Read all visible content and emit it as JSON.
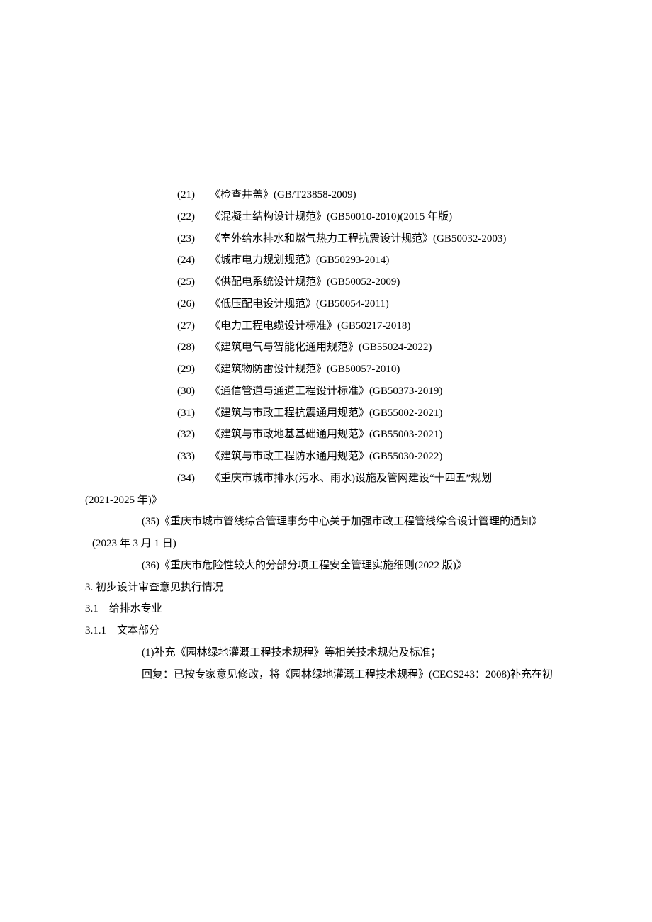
{
  "refs": [
    {
      "num": "(21)",
      "title": "《检查井盖》",
      "code": "(GB/T23858-2009)"
    },
    {
      "num": "(22)",
      "title": "《混凝土结构设计规范》",
      "code": "(GB50010-2010)(2015 年版)"
    },
    {
      "num": "(23)",
      "title": "《室外给水排水和燃气热力工程抗震设计规范》",
      "code": "(GB50032-2003)"
    },
    {
      "num": "(24)",
      "title": "《城市电力规划规范》",
      "code": "(GB50293-2014)"
    },
    {
      "num": "(25)",
      "title": "《供配电系统设计规范》",
      "code": "(GB50052-2009)"
    },
    {
      "num": "(26)",
      "title": "《低压配电设计规范》",
      "code": "(GB50054-2011)"
    },
    {
      "num": "(27)",
      "title": "《电力工程电缆设计标准》",
      "code": "(GB50217-2018)"
    },
    {
      "num": "(28)",
      "title": "《建筑电气与智能化通用规范》",
      "code": "(GB55024-2022)"
    },
    {
      "num": "(29)",
      "title": "《建筑物防雷设计规范》",
      "code": "(GB50057-2010)"
    },
    {
      "num": "(30)",
      "title": "《通信管道与通道工程设计标准》",
      "code": "(GB50373-2019)"
    },
    {
      "num": "(31)",
      "title": "《建筑与市政工程抗震通用规范》",
      "code": "(GB55002-2021)"
    },
    {
      "num": "(32)",
      "title": "《建筑与市政地基基础通用规范》",
      "code": "(GB55003-2021)"
    },
    {
      "num": "(33)",
      "title": "《建筑与市政工程防水通用规范》",
      "code": "(GB55030-2022)"
    }
  ],
  "ref34": {
    "num": "(34)",
    "line1": "《重庆市城市排水(污水、雨水)设施及管网建设“十四五”规划",
    "line2": "(2021-2025 年)》"
  },
  "ref35": {
    "line1": "(35)《重庆市城市管线综合管理事务中心关于加强市政工程管线综合设计管理的通知》",
    "line2": "(2023 年 3 月 1 日)"
  },
  "ref36": "(36)《重庆市危险性较大的分部分项工程安全管理实施细则(2022 版)》",
  "section3": "3. 初步设计审查意见执行情况",
  "section3_1": "3.1 给排水专业",
  "section3_1_1": "3.1.1 文本部分",
  "item1": "(1)补充《园林绿地灌溉工程技术规程》等相关技术规范及标准；",
  "reply": {
    "prefix": "回复：已按专家意见修改，将《园林绿地灌溉工程技术规程》",
    "code": "(CECS243：2008)",
    "suffix": "补充在初"
  }
}
